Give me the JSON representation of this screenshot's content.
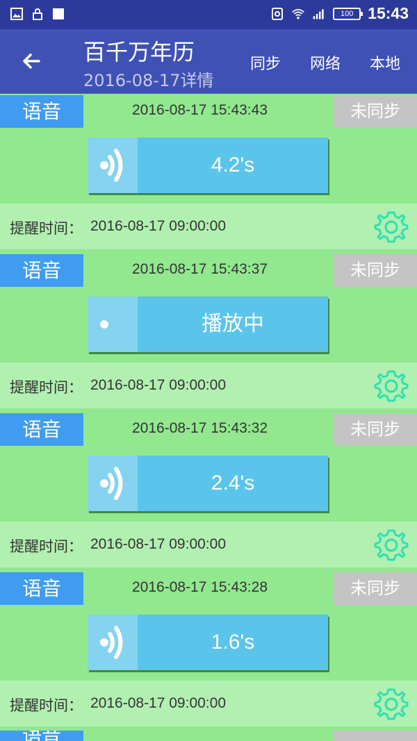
{
  "statusbar": {
    "time": "15:43",
    "battery": "100",
    "icons": [
      "gallery-icon",
      "lock-icon",
      "square-icon",
      "sim-icon",
      "wifi-icon",
      "signal-icon"
    ]
  },
  "appbar": {
    "title": "百千万年历",
    "subtitle": "2016-08-17详情",
    "actions": [
      "同步",
      "网络",
      "本地"
    ]
  },
  "cards": [
    {
      "tag": "语音",
      "timestamp": "2016-08-17 15:43:43",
      "sync": "未同步",
      "duration": "4.2's",
      "remind_label": "提醒时间：",
      "remind_time": "2016-08-17 09:00:00",
      "playing": false
    },
    {
      "tag": "语音",
      "timestamp": "2016-08-17 15:43:37",
      "sync": "未同步",
      "duration": "播放中",
      "remind_label": "提醒时间：",
      "remind_time": "2016-08-17 09:00:00",
      "playing": true
    },
    {
      "tag": "语音",
      "timestamp": "2016-08-17 15:43:32",
      "sync": "未同步",
      "duration": "2.4's",
      "remind_label": "提醒时间：",
      "remind_time": "2016-08-17 09:00:00",
      "playing": false
    },
    {
      "tag": "语音",
      "timestamp": "2016-08-17 15:43:28",
      "sync": "未同步",
      "duration": "1.6's",
      "remind_label": "提醒时间：",
      "remind_time": "2016-08-17 09:00:00",
      "playing": false
    }
  ],
  "partial_card": {
    "tag": "语音"
  },
  "colors": {
    "statusbar": "#2c3a9c",
    "appbar": "#3f51b5",
    "background": "#92e88f",
    "remind_row": "#b1f0b0",
    "tag": "#3f9cf0",
    "sync": "#c4c4c4",
    "voice_button": "#5bc4ea",
    "gear": "#2ee0b0"
  }
}
